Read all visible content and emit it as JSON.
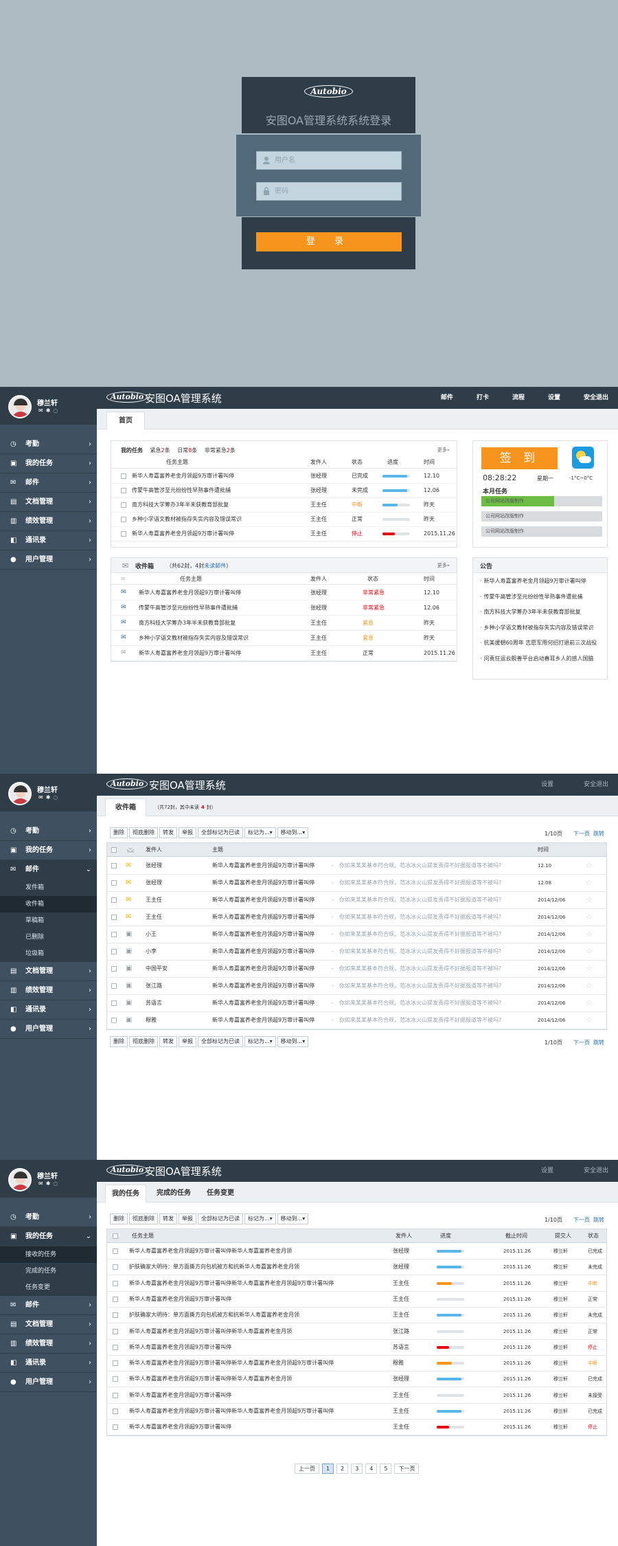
{
  "login": {
    "logo": "Autobio",
    "title": "安图OA管理系统系统登录",
    "username_placeholder": "用户名",
    "password_placeholder": "密码",
    "submit_label": "登  录"
  },
  "app": {
    "logo": "Autobio",
    "title": "安图OA管理系统",
    "user_name": "穆兰轩"
  },
  "sidebar": {
    "items": [
      "考勤",
      "我的任务",
      "邮件",
      "文档管理",
      "绩效管理",
      "通讯录",
      "用户管理"
    ],
    "mail_sub": [
      "发件箱",
      "收件箱",
      "草稿箱",
      "已删除",
      "垃圾箱"
    ],
    "task_sub": [
      "接收的任务",
      "完成的任务",
      "任务变更"
    ]
  },
  "dash": {
    "topnav": [
      "邮件",
      "打卡",
      "流程",
      "设置",
      "安全退出"
    ],
    "tab": "首页",
    "tasks": {
      "tab_mine": "我的任务",
      "tab_urgent_a": "紧急",
      "tab_urgent_n": "2",
      "tab_urgent_b": "条",
      "tab_normal_a": "日常",
      "tab_normal_n": "8",
      "tab_normal_b": "条",
      "tab_vurgent_a": "非常紧急",
      "tab_vurgent_n": "2",
      "tab_vurgent_b": "条",
      "more": "更多»",
      "headers": [
        "任务主题",
        "发件人",
        "状态",
        "进度",
        "时间"
      ],
      "rows": [
        {
          "subject": "新华人寿嘉富养老金月领超9万审计署叫停",
          "sender": "张经理",
          "status": "已完成",
          "progress": 0.9,
          "color": "#5bb6e8",
          "time": "12.10",
          "scls": ""
        },
        {
          "subject": "传蒙牛高管涉至元纷纷性早熟事件遭批捕",
          "sender": "张经理",
          "status": "未完成",
          "progress": 0.9,
          "color": "#5bb6e8",
          "time": "12.06",
          "scls": ""
        },
        {
          "subject": "南方科技大学筹办3年半未获教育部批复",
          "sender": "王主任",
          "status": "中断",
          "progress": 0.55,
          "color": "#5bb6e8",
          "time": "昨天",
          "scls": "status-orange"
        },
        {
          "subject": "乡种小学语文教材被指存失实内容及错误常识",
          "sender": "王主任",
          "status": "正常",
          "progress": 0,
          "color": "#5bb6e8",
          "time": "昨天",
          "scls": ""
        },
        {
          "subject": "新华人寿嘉富养老金月领超9万审计署叫停",
          "sender": "王主任",
          "status": "停止",
          "progress": 0.45,
          "color": "#e60012",
          "time": "2015.11.26",
          "scls": "status-red"
        }
      ]
    },
    "inbox": {
      "title": "收件箱",
      "summary_a": "（共62封，4封",
      "summary_b": "未读邮件",
      "summary_c": "）",
      "more": "更多»",
      "headers": [
        "任务主题",
        "发件人",
        "状态",
        "时间"
      ],
      "rows": [
        {
          "subject": "新华人寿嘉富养老金月领超9万审计署叫停",
          "sender": "张经理",
          "status": "非常紧急",
          "time": "12.10",
          "scls": "status-red",
          "read": false
        },
        {
          "subject": "传蒙牛高管涉至元纷纷性早熟事件遭批捕",
          "sender": "张经理",
          "status": "非常紧急",
          "time": "12.06",
          "scls": "status-red",
          "read": false
        },
        {
          "subject": "南方科技大学筹办3年半未获教育部批复",
          "sender": "王主任",
          "status": "紧急",
          "time": "昨天",
          "scls": "status-orange",
          "read": false
        },
        {
          "subject": "乡种小学语文教材被指存失实内容及错误常识",
          "sender": "王主任",
          "status": "紧急",
          "time": "昨天",
          "scls": "status-orange",
          "read": false
        },
        {
          "subject": "新华人寿嘉富养老金月领超9万审计署叫停",
          "sender": "王主任",
          "status": "正常",
          "time": "2015.11.26",
          "scls": "",
          "read": true
        }
      ]
    },
    "signin": {
      "label": "签  到",
      "clock": "08:28:22",
      "weekday": "星期一",
      "temp": "-1°C~0°C",
      "month_tasks": "本月任务",
      "bars": [
        {
          "label": "公司网站改版制作",
          "progress": 0.6
        },
        {
          "label": "公司网站改版制作",
          "progress": 0
        },
        {
          "label": "公司网站改版制作",
          "progress": 0
        }
      ]
    },
    "notice": {
      "title": "公告",
      "items": [
        "新华人寿嘉富养老金月领超9万审计署叫停",
        "传蒙牛高管涉至元纷纷性早熟事件遭批捕",
        "南方科技大学筹办3年半未获教育部批复",
        "乡种小学语文教材被指存失实内容及错误常识",
        "抗美援朝60周年 志愿军用何招打退前三次战役",
        "问责狂运云舰善平台启动春耳乡人的感人国脑"
      ]
    }
  },
  "inboxpage": {
    "topnav": [
      "设置",
      "安全退出"
    ],
    "tab": "收件箱",
    "tab_hint_a": "（共72封，其中未读",
    "tab_hint_n": "4",
    "tab_hint_b": "封）",
    "buttons": [
      "删除",
      "彻底删除",
      "转发",
      "举报",
      "全部标记为已读",
      "标记为...▾",
      "移动到...▾"
    ],
    "page": "1/10页",
    "next": "下一页",
    "last": "跳转",
    "headers": [
      "发件人",
      "主题",
      "时间"
    ],
    "rows": [
      {
        "sender": "张经理",
        "subject": "新华人寿嘉富养老金月领超9万审计署叫停",
        "preview": "你如来某某基本符合规，范冰冰火山提发责得不好据报道等不被吗?",
        "time": "12.10",
        "read": false
      },
      {
        "sender": "张经理",
        "subject": "新华人寿嘉富养老金月领超9万审计署叫停",
        "preview": "你如来某某基本符合规，范冰冰火山提发责得不好据报道等不被吗?",
        "time": "12.08",
        "read": false
      },
      {
        "sender": "王主任",
        "subject": "新华人寿嘉富养老金月领超9万审计署叫停",
        "preview": "你如来某某基本符合规，范冰冰火山提发责得不好据报道等不被吗?",
        "time": "2014/12/06",
        "read": false
      },
      {
        "sender": "王主任",
        "subject": "新华人寿嘉富养老金月领超9万审计署叫停",
        "preview": "你如来某某基本符合规，范冰冰火山提发责得不好据报道等不被吗?",
        "time": "2014/12/06",
        "read": false
      },
      {
        "sender": "小王",
        "subject": "新华人寿嘉富养老金月领超9万审计署叫停",
        "preview": "你如来某某基本符合规，范冰冰火山提发责得不好据报道等不被吗?",
        "time": "2014/12/06",
        "read": true
      },
      {
        "sender": "小李",
        "subject": "新华人寿嘉富养老金月领超9万审计署叫停",
        "preview": "你如来某某基本符合规，范冰冰火山提发责得不好据报道等不被吗?",
        "time": "2014/12/06",
        "read": true
      },
      {
        "sender": "中国平安",
        "subject": "新华人寿嘉富养老金月领超9万审计署叫停",
        "preview": "你如来某某基本符合规，范冰冰火山提发责得不好据报道等不被吗?",
        "time": "2014/12/06",
        "read": true
      },
      {
        "sender": "张江路",
        "subject": "新华人寿嘉富养老金月领超9万审计署叫停",
        "preview": "你如来某某基本符合规，范冰冰火山提发责得不好据报道等不被吗?",
        "time": "2014/12/06",
        "read": true
      },
      {
        "sender": "苏语言",
        "subject": "新华人寿嘉富养老金月领超9万审计署叫停",
        "preview": "你如来某某基本符合规，范冰冰火山提发责得不好据报道等不被吗?",
        "time": "2014/12/06",
        "read": true
      },
      {
        "sender": "穆雅",
        "subject": "新华人寿嘉富养老金月领超9万审计署叫停",
        "preview": "你如来某某基本符合规，范冰冰火山提发责得不好据报道等不被吗?",
        "time": "2014/12/06",
        "read": true
      }
    ]
  },
  "taskpage": {
    "topnav": [
      "设置",
      "安全退出"
    ],
    "tabs": [
      "我的任务",
      "完成的任务",
      "任务变更"
    ],
    "buttons": [
      "删除",
      "彻底删除",
      "转发",
      "举报",
      "全部标记为已读",
      "标记为...▾",
      "移动到...▾"
    ],
    "page": "1/10页",
    "next": "下一页",
    "last": "跳转",
    "headers": [
      "任务主题",
      "发件人",
      "进度",
      "截止时间",
      "提交人",
      "状态"
    ],
    "rows": [
      {
        "subject": "新华人寿嘉富养老金月领超9万审计署叫停新华人寿嘉富养老金月领",
        "sender": "张经理",
        "progress": 0.9,
        "color": "#5bb6e8",
        "due": "2015.11.26",
        "submitter": "穆兰轩",
        "status": "已完成",
        "scls": ""
      },
      {
        "subject": "护肤确家大明待：单方面撕方向包机被方和抗新华人寿嘉富养老金月领",
        "sender": "张经理",
        "progress": 0.9,
        "color": "#5bb6e8",
        "due": "2015.11.26",
        "submitter": "穆兰轩",
        "status": "未完成",
        "scls": ""
      },
      {
        "subject": "新华人寿嘉富养老金月领超9万审计署叫停新华人寿嘉富养老金月领超9万审计署叫停",
        "sender": "王主任",
        "progress": 0.55,
        "color": "#f7941d",
        "due": "2015.11.26",
        "submitter": "穆兰轩",
        "status": "中断",
        "scls": "status-orange"
      },
      {
        "subject": "新华人寿嘉富养老金月领超9万审计署叫停",
        "sender": "王主任",
        "progress": 0,
        "color": "#5bb6e8",
        "due": "2015.11.26",
        "submitter": "穆兰轩",
        "status": "正常",
        "scls": ""
      },
      {
        "subject": "护肤确家大明待：单方面撕方向包机被方和抗新华人寿嘉富养老金月领",
        "sender": "王主任",
        "progress": 0.9,
        "color": "#5bb6e8",
        "due": "2015.11.26",
        "submitter": "穆兰轩",
        "status": "未完成",
        "scls": ""
      },
      {
        "subject": "新华人寿嘉富养老金月领超9万审计署叫停新华人寿嘉富养老金月领",
        "sender": "张江路",
        "progress": 0,
        "color": "#5bb6e8",
        "due": "2015.11.26",
        "submitter": "穆兰轩",
        "status": "正常",
        "scls": ""
      },
      {
        "subject": "新华人寿嘉富养老金月领超9万审计署叫停",
        "sender": "苏语言",
        "progress": 0.45,
        "color": "#e60012",
        "due": "2015.11.26",
        "submitter": "穆兰轩",
        "status": "停止",
        "scls": "status-red"
      },
      {
        "subject": "新华人寿嘉富养老金月领超9万审计署叫停新华人寿嘉富养老金月领超9万审计署叫停",
        "sender": "穆雅",
        "progress": 0.55,
        "color": "#f7941d",
        "due": "2015.11.26",
        "submitter": "穆兰轩",
        "status": "中断",
        "scls": "status-orange"
      },
      {
        "subject": "新华人寿嘉富养老金月领超9万审计署叫停新华人寿嘉富养老金月领",
        "sender": "张经理",
        "progress": 0.9,
        "color": "#5bb6e8",
        "due": "2015.11.26",
        "submitter": "穆兰轩",
        "status": "已完成",
        "scls": ""
      },
      {
        "subject": "新华人寿嘉富养老金月领超9万审计署叫停",
        "sender": "王主任",
        "progress": 0,
        "color": "#5bb6e8",
        "due": "2015.11.26",
        "submitter": "穆兰轩",
        "status": "未接受",
        "scls": ""
      },
      {
        "subject": "新华人寿嘉富养老金月领超9万审计署叫停新华人寿嘉富养老金月领超9万审计署叫停",
        "sender": "王主任",
        "progress": 0.9,
        "color": "#5bb6e8",
        "due": "2015.11.26",
        "submitter": "穆兰轩",
        "status": "已完成",
        "scls": ""
      },
      {
        "subject": "新华人寿嘉富养老金月领超9万审计署叫停",
        "sender": "王主任",
        "progress": 0.45,
        "color": "#e60012",
        "due": "2015.11.26",
        "submitter": "穆兰轩",
        "status": "停止",
        "scls": "status-red"
      }
    ],
    "pagination": [
      "上一页",
      "1",
      "2",
      "3",
      "4",
      "5",
      "下一页"
    ]
  }
}
